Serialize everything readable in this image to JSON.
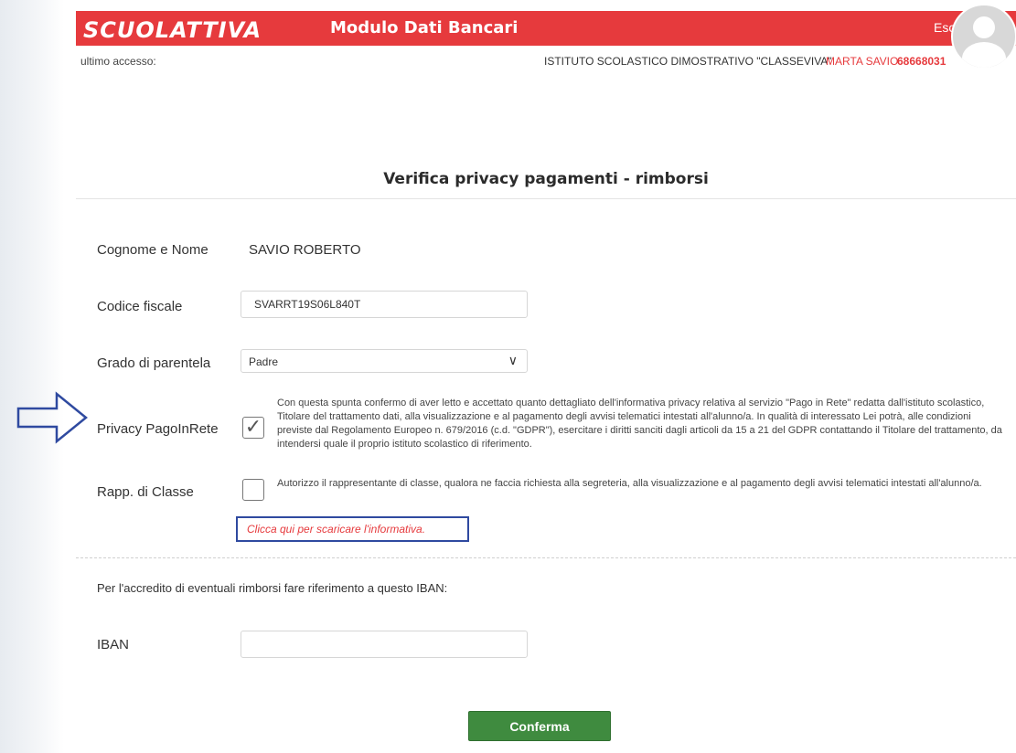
{
  "header": {
    "logo": "SCUOLATTIVA",
    "title": "Modulo Dati Bancari",
    "logout_label": "Esci",
    "brand_color": "#e63a3d"
  },
  "info": {
    "last_access_label": "ultimo accesso:",
    "institute": "ISTITUTO SCOLASTICO DIMOSTRATIVO \"CLASSEVIVA\"",
    "user_name": "MARTA SAVIO",
    "user_code": "68668031"
  },
  "page": {
    "title": "Verifica privacy pagamenti - rimborsi"
  },
  "form": {
    "name_label": "Cognome e Nome",
    "name_value": "SAVIO ROBERTO",
    "fiscal_code_label": "Codice fiscale",
    "fiscal_code_value": "SVARRT19S06L840T",
    "kinship_label": "Grado di parentela",
    "kinship_value": "Padre",
    "privacy_label": "Privacy PagoInRete",
    "privacy_checked": true,
    "privacy_text": "Con questa spunta confermo di aver letto e accettato quanto dettagliato dell'informativa privacy relativa al servizio \"Pago in Rete\" redatta dall'istituto scolastico, Titolare del trattamento dati, alla visualizzazione e al pagamento degli avvisi telematici intestati all'alunno/a. In qualità di interessato Lei potrà, alle condizioni previste dal Regolamento Europeo n. 679/2016 (c.d. \"GDPR\"), esercitare i diritti sanciti dagli articoli da 15 a 21 del GDPR contattando il Titolare del trattamento, da intendersi quale il proprio istituto scolastico di riferimento.",
    "class_rep_label": "Rapp. di Classe",
    "class_rep_checked": false,
    "class_rep_text": "Autorizzo il rappresentante di classe, qualora ne faccia richiesta alla segreteria, alla visualizzazione e al pagamento degli avvisi telematici intestati all'alunno/a.",
    "download_link": "Clicca qui per scaricare l'informativa.",
    "iban_note": "Per l'accredito di eventuali rimborsi fare riferimento a questo IBAN:",
    "iban_label": "IBAN",
    "iban_value": "",
    "confirm_label": "Conferma"
  },
  "icons": {
    "privacy_check": "checkmark-icon",
    "select_chevron": "chevron-down-icon",
    "avatar": "user-avatar-icon",
    "annotation": "arrow-right-icon"
  }
}
